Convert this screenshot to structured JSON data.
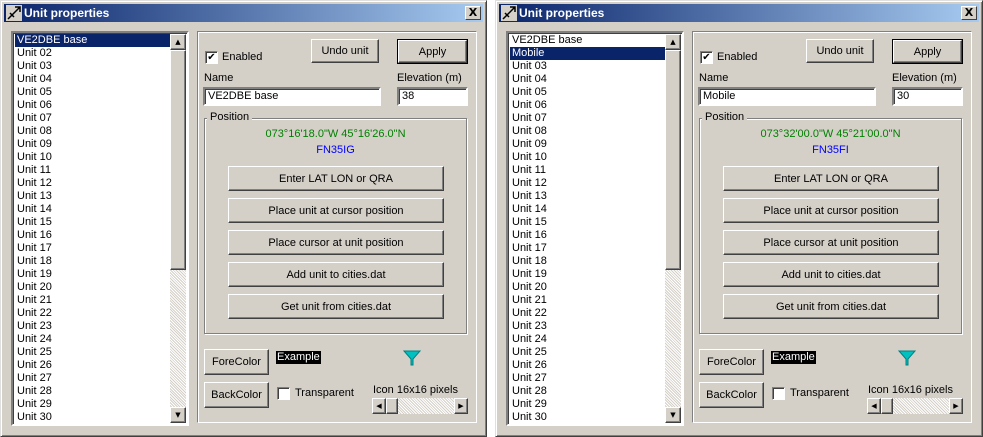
{
  "colors": {
    "titlebar_start": "#0a246a",
    "titlebar_end": "#a6caf0",
    "coords_green": "#008000",
    "qra_blue": "#0000ff",
    "funnel_cyan": "#00c0c0",
    "selection": "#0a246a"
  },
  "icons": {
    "title": "unit-properties-icon",
    "close": "close-icon",
    "funnel": "funnel-icon"
  },
  "windows": [
    {
      "title": "Unit properties",
      "close_label": "X",
      "units": [
        "VE2DBE base",
        "Unit 02",
        "Unit 03",
        "Unit 04",
        "Unit 05",
        "Unit 06",
        "Unit 07",
        "Unit 08",
        "Unit 09",
        "Unit 10",
        "Unit 11",
        "Unit 12",
        "Unit 13",
        "Unit 14",
        "Unit 15",
        "Unit 16",
        "Unit 17",
        "Unit 18",
        "Unit 19",
        "Unit 20",
        "Unit 21",
        "Unit 22",
        "Unit 23",
        "Unit 24",
        "Unit 25",
        "Unit 26",
        "Unit 27",
        "Unit 28",
        "Unit 29",
        "Unit 30"
      ],
      "selected_index": 0,
      "enabled_label": "Enabled",
      "enabled_checked": "✔",
      "undo_label": "Undo unit",
      "apply_label": "Apply",
      "name_label": "Name",
      "name_value": "VE2DBE base",
      "elevation_label": "Elevation (m)",
      "elevation_value": "38",
      "position_label": "Position",
      "coords": "073°16'18.0\"W 45°16'26.0\"N",
      "qra": "FN35IG",
      "enter_btn": "Enter LAT LON or QRA",
      "place_unit_btn": "Place unit at cursor position",
      "place_cursor_btn": "Place cursor at unit position",
      "add_city_btn": "Add unit to cities.dat",
      "get_city_btn": "Get unit from cities.dat",
      "forecolor_btn": "ForeColor",
      "backcolor_btn": "BackColor",
      "example_text": "Example",
      "transparent_label": "Transparent",
      "icon_label": "Icon 16x16 pixels"
    },
    {
      "title": "Unit properties",
      "close_label": "X",
      "units": [
        "VE2DBE base",
        "Mobile",
        "Unit 03",
        "Unit 04",
        "Unit 05",
        "Unit 06",
        "Unit 07",
        "Unit 08",
        "Unit 09",
        "Unit 10",
        "Unit 11",
        "Unit 12",
        "Unit 13",
        "Unit 14",
        "Unit 15",
        "Unit 16",
        "Unit 17",
        "Unit 18",
        "Unit 19",
        "Unit 20",
        "Unit 21",
        "Unit 22",
        "Unit 23",
        "Unit 24",
        "Unit 25",
        "Unit 26",
        "Unit 27",
        "Unit 28",
        "Unit 29",
        "Unit 30"
      ],
      "selected_index": 1,
      "enabled_label": "Enabled",
      "enabled_checked": "✔",
      "undo_label": "Undo unit",
      "apply_label": "Apply",
      "name_label": "Name",
      "name_value": "Mobile",
      "elevation_label": "Elevation (m)",
      "elevation_value": "30",
      "position_label": "Position",
      "coords": "073°32'00.0\"W 45°21'00.0\"N",
      "qra": "FN35FI",
      "enter_btn": "Enter LAT LON or QRA",
      "place_unit_btn": "Place unit at cursor position",
      "place_cursor_btn": "Place cursor at unit position",
      "add_city_btn": "Add unit to cities.dat",
      "get_city_btn": "Get unit from cities.dat",
      "forecolor_btn": "ForeColor",
      "backcolor_btn": "BackColor",
      "example_text": "Example",
      "transparent_label": "Transparent",
      "icon_label": "Icon 16x16 pixels"
    }
  ]
}
